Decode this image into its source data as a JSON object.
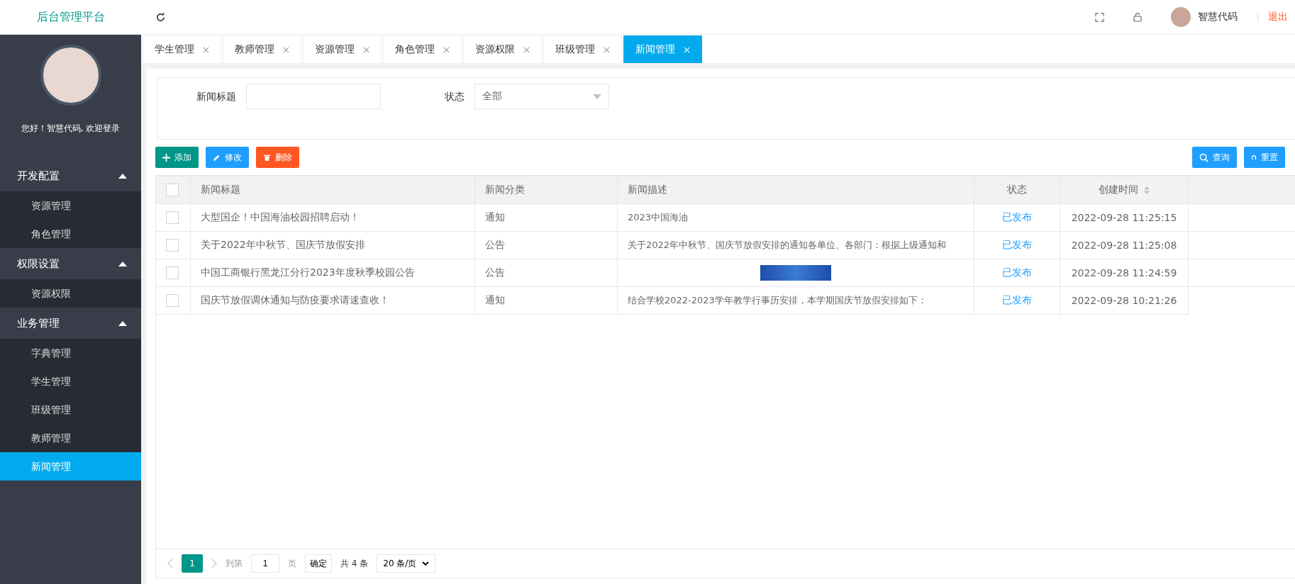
{
  "header": {
    "title": "后台管理平台",
    "user_name": "智慧代码",
    "logout": "退出"
  },
  "sidebar": {
    "greeting": "您好！智慧代码, 欢迎登录",
    "groups": [
      {
        "label": "开发配置",
        "expanded": true,
        "children": [
          {
            "label": "资源管理",
            "selected": false
          },
          {
            "label": "角色管理",
            "selected": false
          }
        ]
      },
      {
        "label": "权限设置",
        "expanded": true,
        "children": [
          {
            "label": "资源权限",
            "selected": false
          }
        ]
      },
      {
        "label": "业务管理",
        "expanded": true,
        "children": [
          {
            "label": "字典管理",
            "selected": false
          },
          {
            "label": "学生管理",
            "selected": false
          },
          {
            "label": "班级管理",
            "selected": false
          },
          {
            "label": "教师管理",
            "selected": false
          },
          {
            "label": "新闻管理",
            "selected": true
          }
        ]
      }
    ]
  },
  "tabs": [
    {
      "label": "学生管理",
      "selected": false
    },
    {
      "label": "教师管理",
      "selected": false
    },
    {
      "label": "资源管理",
      "selected": false
    },
    {
      "label": "角色管理",
      "selected": false
    },
    {
      "label": "资源权限",
      "selected": false
    },
    {
      "label": "班级管理",
      "selected": false
    },
    {
      "label": "新闻管理",
      "selected": true
    }
  ],
  "filters": {
    "title_label": "新闻标题",
    "status_label": "状态",
    "status_value": "全部"
  },
  "actions": [
    {
      "kind": "add",
      "label": "添加"
    },
    {
      "kind": "edit",
      "label": "修改"
    },
    {
      "kind": "delete",
      "label": "删除"
    }
  ],
  "search_buttons": [
    {
      "kind": "search",
      "label": "查询"
    },
    {
      "kind": "reset",
      "label": "重置"
    }
  ],
  "table": {
    "select_all_checked": false,
    "columns": [
      {
        "label": "新闻标题",
        "sortable": false
      },
      {
        "label": "新闻分类",
        "sortable": false
      },
      {
        "label": "新闻描述",
        "sortable": false
      },
      {
        "label": "状态",
        "sortable": false
      },
      {
        "label": "创建时间",
        "sortable": true
      }
    ],
    "rows": [
      {
        "checked": false,
        "title": "大型国企！中国海油校园招聘启动！",
        "category": "通知",
        "kind": "text",
        "description": "2023中国海油",
        "status": "已发布",
        "created": "2022-09-28 11:25:15"
      },
      {
        "checked": false,
        "title": "关于2022年中秋节、国庆节放假安排",
        "category": "公告",
        "kind": "text",
        "description": "关于2022年中秋节、国庆节放假安排的通知各单位、各部门：根据上级通知和",
        "status": "已发布",
        "created": "2022-09-28 11:25:08"
      },
      {
        "checked": false,
        "title": "中国工商银行黑龙江分行2023年度秋季校园公告",
        "category": "公告",
        "kind": "image",
        "status": "已发布",
        "created": "2022-09-28 11:24:59"
      },
      {
        "checked": false,
        "title": "国庆节放假调休通知与防疫要求请速查收！",
        "category": "通知",
        "kind": "text",
        "description": "结合学校2022-2023学年教学行事历安排，本学期国庆节放假安排如下：",
        "status": "已发布",
        "created": "2022-09-28 10:21:26"
      }
    ]
  },
  "pagination": {
    "current_page": "1",
    "goto_label": "到第",
    "goto_value": "1",
    "page_suffix": "页",
    "confirm": "确定",
    "total": "共 4 条",
    "page_size": "20 条/页"
  }
}
